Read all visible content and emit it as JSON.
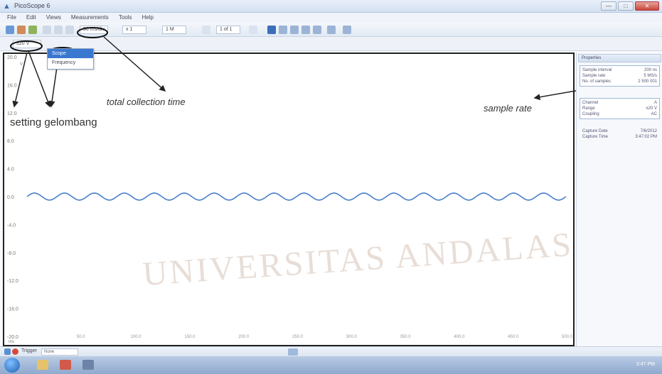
{
  "window": {
    "title": "PicoScope 6"
  },
  "menu": [
    "File",
    "Edit",
    "Views",
    "Measurements",
    "Tools",
    "Help"
  ],
  "toolbar": {
    "collection_time": "50 ms/div",
    "zoom": "x 1",
    "samples": "1 M",
    "buffer": "1 of 1"
  },
  "channel": {
    "range": "±20 V"
  },
  "dropdown": {
    "options": [
      "Scope",
      "Frequency"
    ]
  },
  "scope": {
    "y_ticks": [
      "20.0",
      "16.0",
      "12.0",
      "8.0",
      "4.0",
      "0.0",
      "-4.0",
      "-8.0",
      "-12.0",
      "-16.0",
      "-20.0"
    ],
    "y_unit": "V",
    "x_ticks": [
      "50.0",
      "100.0",
      "150.0",
      "200.0",
      "250.0",
      "300.0",
      "350.0",
      "400.0",
      "450.0",
      "500.0"
    ],
    "x_unit": "ms",
    "trace_color": "#4a7fc8",
    "waveform": {
      "type": "sine",
      "cycles": 18,
      "amplitude_v": 0.5,
      "offset_v": 0.0
    }
  },
  "annotations": {
    "collection": "total collection time",
    "setting": "setting gelombang",
    "rate": "sample rate"
  },
  "watermark": "UNIVERSITAS ANDALAS",
  "properties": {
    "header": "Properties",
    "sampling": [
      {
        "label": "Sample interval",
        "value": "200 ns"
      },
      {
        "label": "Sample rate",
        "value": "5 MS/s"
      },
      {
        "label": "No. of samples",
        "value": "2 500 001"
      }
    ],
    "channel": [
      {
        "label": "Channel",
        "value": "A"
      },
      {
        "label": "Range",
        "value": "±20 V"
      },
      {
        "label": "Coupling",
        "value": "AC"
      }
    ],
    "capture": [
      {
        "label": "Capture Date",
        "value": "7/6/2012"
      },
      {
        "label": "Capture Time",
        "value": "3:47:02 PM"
      }
    ]
  },
  "trigger": {
    "label": "Trigger",
    "value": "None"
  },
  "taskbar": {
    "clock": "3:47 PM"
  }
}
